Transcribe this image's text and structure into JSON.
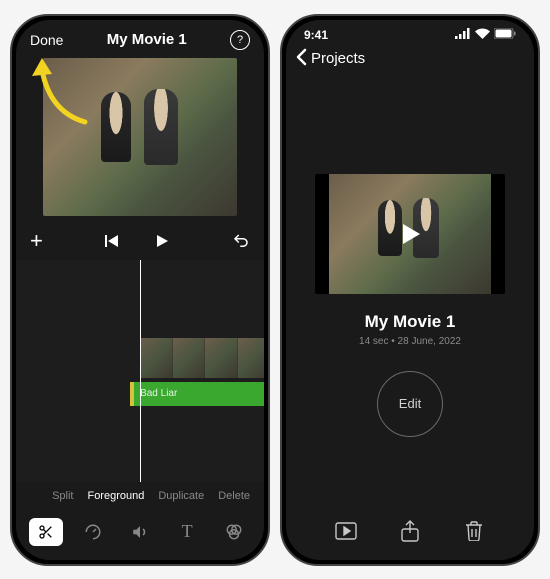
{
  "editor": {
    "done_label": "Done",
    "title": "My Movie 1",
    "help_glyph": "?",
    "audio_clip_label": "Bad Liar",
    "clip_actions": {
      "split": "Split",
      "foreground": "Foreground",
      "duplicate": "Duplicate",
      "delete": "Delete"
    }
  },
  "projects": {
    "status_time": "9:41",
    "back_label": "Projects",
    "title": "My Movie 1",
    "meta": "14 sec • 28 June, 2022",
    "edit_label": "Edit"
  },
  "icons": {
    "help": "help-icon",
    "plus": "plus-icon",
    "skip_back": "skip-back-icon",
    "play": "play-icon",
    "undo": "undo-icon",
    "scissors": "scissors-icon",
    "speed": "speedometer-icon",
    "volume": "volume-icon",
    "text": "text-icon",
    "filters": "filters-icon",
    "chevron_left": "chevron-left-icon",
    "signal": "cellular-signal-icon",
    "wifi": "wifi-icon",
    "battery": "battery-icon",
    "play_overlay": "play-overlay-icon",
    "play_outline": "play-outline-icon",
    "share": "share-icon",
    "trash": "trash-icon"
  },
  "colors": {
    "accent_arrow": "#f2d321",
    "audio_track": "#3aa82f",
    "audio_marker": "#d6c23a"
  }
}
